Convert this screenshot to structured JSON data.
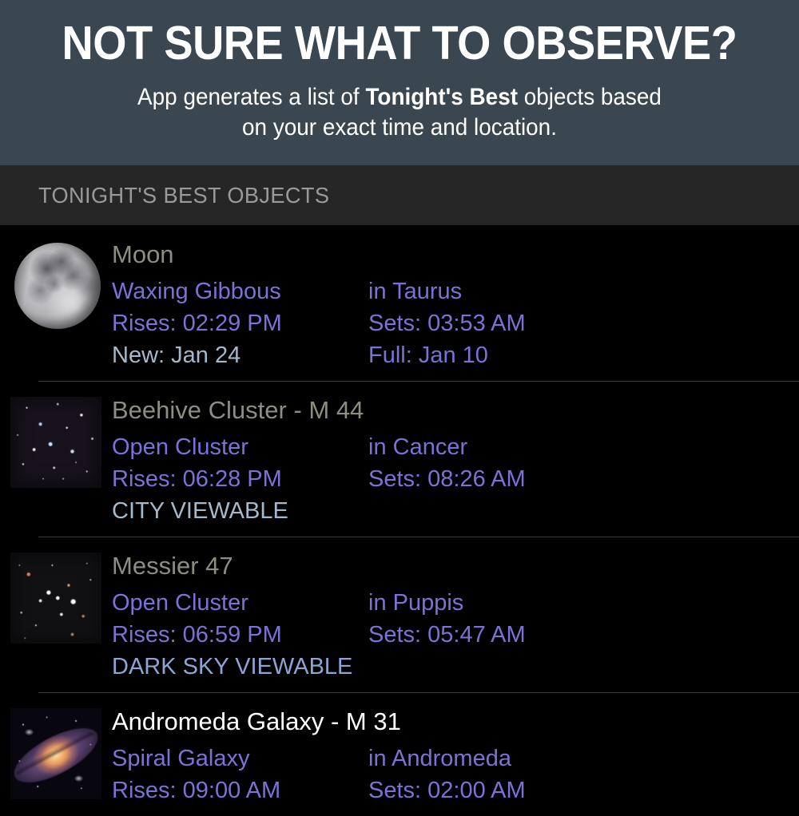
{
  "promo": {
    "headline": "NOT SURE WHAT TO OBSERVE?",
    "sub_pre": "App generates a list of ",
    "sub_bold": "Tonight's Best",
    "sub_post": " objects based",
    "sub_line2": "on your exact time and location."
  },
  "section": {
    "header": "TONIGHT'S BEST OBJECTS"
  },
  "colors": {
    "promo_bg": "#3a4650",
    "section_bg": "#262626",
    "list_bg": "#000000",
    "object_name": "#8d8d82",
    "object_name_bright": "#ffffff",
    "detail_purple": "#7b72d8",
    "tint_blue": "#a4b9cb",
    "tint_blue_alt": "#8ca5d4",
    "divider": "#3b3b3b",
    "section_label": "#9a9a9a"
  },
  "objects": [
    {
      "name": "Moon",
      "thumb": "moon-waxing-gibbous-thumbnail",
      "rows": [
        {
          "left": "Waxing Gibbous",
          "right": "in Taurus",
          "left_tint": "purple",
          "right_tint": "purple"
        },
        {
          "left": "Rises: 02:29 PM",
          "right": "Sets: 03:53 AM",
          "left_tint": "purple",
          "right_tint": "purple"
        },
        {
          "left": "New: Jan 24",
          "right": "Full: Jan 10",
          "left_tint": "blue",
          "right_tint": "purple"
        }
      ]
    },
    {
      "name": "Beehive Cluster - M 44",
      "thumb": "beehive-cluster-thumbnail",
      "rows": [
        {
          "left": "Open Cluster",
          "right": "in Cancer",
          "left_tint": "purple",
          "right_tint": "purple"
        },
        {
          "left": "Rises: 06:28 PM",
          "right": "Sets: 08:26 AM",
          "left_tint": "purple",
          "right_tint": "purple"
        },
        {
          "left": "CITY VIEWABLE",
          "right": "",
          "left_tint": "blue",
          "right_tint": "purple"
        }
      ]
    },
    {
      "name": "Messier 47",
      "thumb": "messier-47-thumbnail",
      "rows": [
        {
          "left": "Open Cluster",
          "right": "in Puppis",
          "left_tint": "purple",
          "right_tint": "purple"
        },
        {
          "left": "Rises: 06:59 PM",
          "right": "Sets: 05:47 AM",
          "left_tint": "purple",
          "right_tint": "purple"
        },
        {
          "left": "DARK SKY VIEWABLE",
          "right": "",
          "left_tint": "blue2",
          "right_tint": "purple"
        }
      ]
    },
    {
      "name": "Andromeda Galaxy - M 31",
      "thumb": "andromeda-galaxy-thumbnail",
      "name_bright": true,
      "rows": [
        {
          "left": "Spiral Galaxy",
          "right": "in Andromeda",
          "left_tint": "purple",
          "right_tint": "purple"
        },
        {
          "left": "Rises: 09:00 AM",
          "right": "Sets: 02:00 AM",
          "left_tint": "purple",
          "right_tint": "purple"
        }
      ]
    }
  ]
}
